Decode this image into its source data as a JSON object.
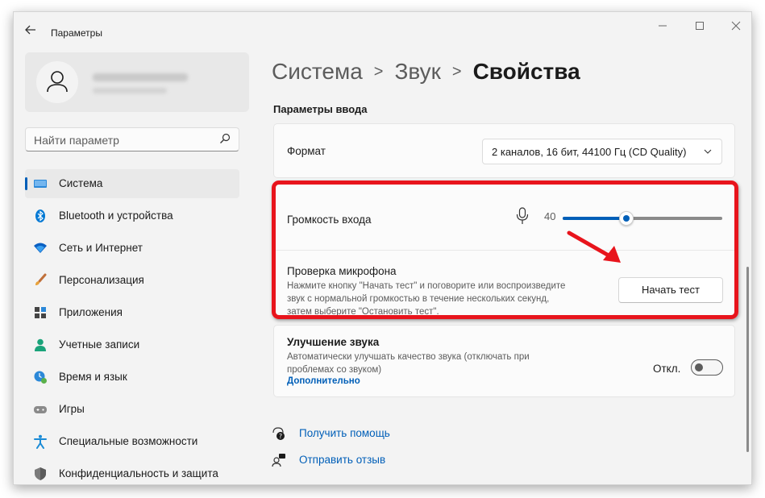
{
  "window": {
    "title": "Параметры",
    "back_icon": "back-arrow-icon",
    "controls": [
      "minimize-icon",
      "maximize-icon",
      "close-icon"
    ]
  },
  "search": {
    "placeholder": "Найти параметр",
    "icon": "search-icon"
  },
  "sidebar": {
    "items": [
      {
        "label": "Система",
        "icon": "system-icon",
        "active": true
      },
      {
        "label": "Bluetooth и устройства",
        "icon": "bluetooth-icon"
      },
      {
        "label": "Сеть и Интернет",
        "icon": "network-icon"
      },
      {
        "label": "Персонализация",
        "icon": "brush-icon"
      },
      {
        "label": "Приложения",
        "icon": "apps-icon"
      },
      {
        "label": "Учетные записи",
        "icon": "accounts-icon"
      },
      {
        "label": "Время и язык",
        "icon": "time-language-icon"
      },
      {
        "label": "Игры",
        "icon": "gaming-icon"
      },
      {
        "label": "Специальные возможности",
        "icon": "accessibility-icon"
      },
      {
        "label": "Конфиденциальность и защита",
        "icon": "shield-icon"
      }
    ]
  },
  "breadcrumb": {
    "parts": [
      "Система",
      "Звук"
    ],
    "current": "Свойства",
    "separator": ">"
  },
  "main": {
    "section_title": "Параметры ввода",
    "format": {
      "label": "Формат",
      "value": "2 каналов, 16 бит, 44100 Гц (CD Quality)"
    },
    "volume": {
      "label": "Громкость входа",
      "value": "40",
      "level": 40
    },
    "mic_test": {
      "label": "Проверка микрофона",
      "description_lines": [
        "Нажмите кнопку \"Начать тест\" и поговорите или воспроизведите",
        "звук с нормальной громкостью в течение нескольких секунд,",
        "затем выберите \"Остановить тест\"."
      ],
      "button": "Начать тест"
    },
    "enhance": {
      "label": "Улучшение звука",
      "description_lines": [
        "Автоматически улучшать качество звука (отключать при",
        "проблемах со звуком)"
      ],
      "link": "Дополнительно",
      "state": "Откл."
    }
  },
  "help": {
    "get_help": "Получить помощь",
    "feedback": "Отправить отзыв"
  },
  "colors": {
    "accent": "#005fb8",
    "annotation": "#e8141c"
  }
}
